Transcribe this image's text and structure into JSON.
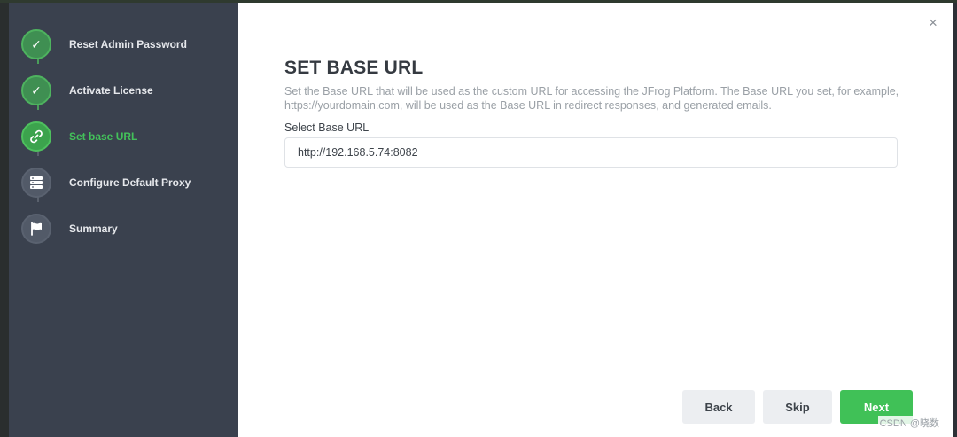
{
  "wizard": {
    "steps": [
      {
        "label": "Reset Admin Password",
        "state": "done",
        "icon": "check-icon",
        "glyph": "✓"
      },
      {
        "label": "Activate License",
        "state": "done",
        "icon": "check-icon",
        "glyph": "✓"
      },
      {
        "label": "Set base URL",
        "state": "active",
        "icon": "link-icon"
      },
      {
        "label": "Configure Default Proxy",
        "state": "pending",
        "icon": "server-icon"
      },
      {
        "label": "Summary",
        "state": "pending",
        "icon": "flag-icon"
      }
    ]
  },
  "main": {
    "title": "SET BASE URL",
    "description": "Set the Base URL that will be used as the custom URL for accessing the JFrog Platform. The Base URL you set, for example, https://yourdomain.com, will be used as the Base URL in redirect responses, and generated emails.",
    "field_label": "Select Base URL",
    "field_value": "http://192.168.5.74:8082",
    "close_glyph": "×"
  },
  "footer": {
    "back_label": "Back",
    "skip_label": "Skip",
    "next_label": "Next"
  },
  "watermark": "CSDN @晓数",
  "colors": {
    "sidebar_bg": "#3a414e",
    "accent_green": "#40c157",
    "done_green": "#3f8f52",
    "pending_gray": "#525a68"
  }
}
